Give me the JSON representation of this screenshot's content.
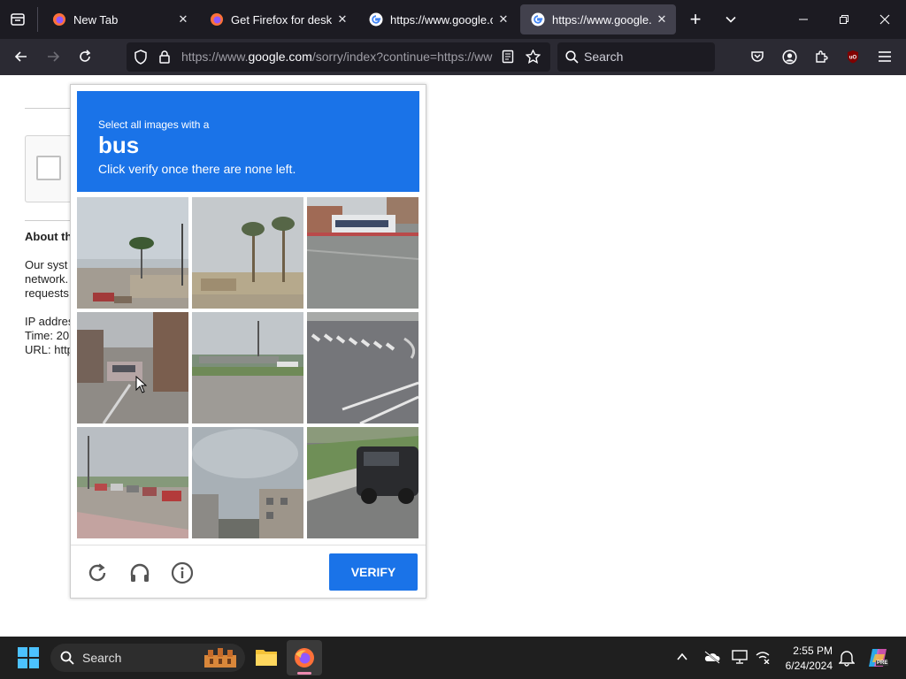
{
  "browser": {
    "tabs": [
      {
        "title": "New Tab",
        "favicon": "firefox-icon",
        "active": false
      },
      {
        "title": "Get Firefox for desktop",
        "favicon": "firefox-icon",
        "active": false
      },
      {
        "title": "https://www.google.com",
        "favicon": "google-icon",
        "active": false
      },
      {
        "title": "https://www.google.com",
        "favicon": "google-icon",
        "active": true
      }
    ],
    "close_glyph": "✕",
    "new_tab_glyph": "+",
    "url_prefix": "https://www.",
    "url_domain": "google.com",
    "url_suffix": "/sorry/index?continue=https://ww",
    "search_placeholder": "Search",
    "accent_color": "#1a73e8"
  },
  "page": {
    "about_heading": "About th",
    "para": [
      "Our syst",
      "network.",
      "requests"
    ],
    "info": [
      "IP addres",
      "Time: 20",
      "URL: http"
    ]
  },
  "captcha": {
    "instruction_line1": "Select all images with a",
    "target": "bus",
    "instruction_line3": "Click verify once there are none left.",
    "verify_label": "VERIFY",
    "tiles": [
      "palm-street-scene",
      "palm-trees-scene",
      "bus-intersection-scene",
      "parked-cars-scene",
      "road-parking-scene",
      "crosswalk-scene",
      "street-cars-scene",
      "sky-buildings-scene",
      "suv-street-scene"
    ]
  },
  "taskbar": {
    "search_placeholder": "Search",
    "time": "2:55 PM",
    "date": "6/24/2024",
    "copilot_badge": "PRE"
  }
}
